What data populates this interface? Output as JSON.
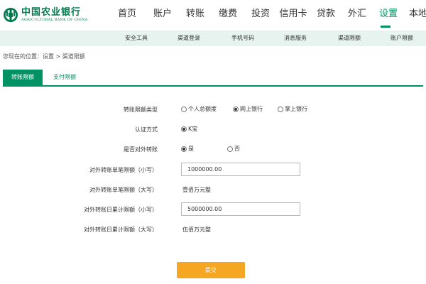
{
  "brand": {
    "name_cn": "中国农业银行",
    "name_en": "AGRICULTURAL BANK OF CHINA",
    "logo_icon": "abc-coin-logo-icon",
    "color": "#007a4d"
  },
  "colors": {
    "accent": "#009262",
    "subnav_bg": "#e6f3ee",
    "submit": "#f5a623"
  },
  "nav": {
    "items": [
      {
        "label": "首页"
      },
      {
        "label": "账户"
      },
      {
        "label": "转账"
      },
      {
        "label": "缴费"
      },
      {
        "label": "投资"
      },
      {
        "label": "信用卡"
      },
      {
        "label": "贷款"
      },
      {
        "label": "外汇"
      },
      {
        "label": "设置"
      },
      {
        "label": "本地"
      }
    ],
    "active": "设置"
  },
  "subnav": {
    "items": [
      {
        "label": "安全工具"
      },
      {
        "label": "渠道登录"
      },
      {
        "label": "手机号码"
      },
      {
        "label": "消息服务"
      },
      {
        "label": "渠道限额"
      },
      {
        "label": "账户限额"
      }
    ]
  },
  "breadcrumb": "您现在的位置：设置 > 渠道限额",
  "tabs": [
    {
      "label": "转账限额"
    },
    {
      "label": "支付限额"
    }
  ],
  "active_tab": "转账限额",
  "form": {
    "limit_type": {
      "label": "转账限额类型",
      "options": [
        "个人总额度",
        "网上银行",
        "掌上银行"
      ],
      "selected": "网上银行"
    },
    "auth_method": {
      "label": "认证方式",
      "options": [
        "K宝"
      ],
      "selected": "K宝"
    },
    "external_transfer": {
      "label": "是否对外转账",
      "options": [
        "是",
        "否"
      ],
      "selected": "是"
    },
    "single_limit_small": {
      "label": "对外转账单笔限额（小写）",
      "value": "1000000.00"
    },
    "single_limit_big": {
      "label": "对外转账单笔限额（大写）",
      "value": "壹佰万元整"
    },
    "daily_limit_small": {
      "label": "对外转账日累计限额（小写）",
      "value": "5000000.00"
    },
    "daily_limit_big": {
      "label": "对外转账日累计限额（大写）",
      "value": "伍佰万元整"
    }
  },
  "submit_label": "提交"
}
